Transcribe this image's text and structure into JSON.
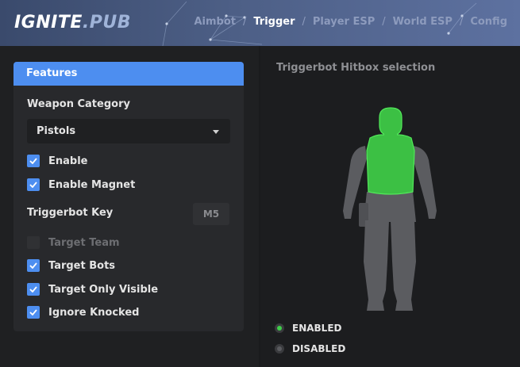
{
  "header": {
    "logo_main": "IGNITE",
    "logo_suffix": ".PUB",
    "tabs": [
      {
        "label": "Aimbot",
        "active": false
      },
      {
        "label": "Trigger",
        "active": true
      },
      {
        "label": "Player ESP",
        "active": false
      },
      {
        "label": "World ESP",
        "active": false
      },
      {
        "label": "Config",
        "active": false
      }
    ],
    "separator": "/"
  },
  "features": {
    "title": "Features",
    "weapon_category_label": "Weapon Category",
    "weapon_category_value": "Pistols",
    "enable": {
      "label": "Enable",
      "checked": true
    },
    "enable_magnet": {
      "label": "Enable Magnet",
      "checked": true
    },
    "trigger_key_label": "Triggerbot Key",
    "trigger_key_value": "M5",
    "target_team": {
      "label": "Target Team",
      "checked": false
    },
    "target_bots": {
      "label": "Target Bots",
      "checked": true
    },
    "target_only_visible": {
      "label": "Target Only Visible",
      "checked": true
    },
    "ignore_knocked": {
      "label": "Ignore Knocked",
      "checked": true
    }
  },
  "hitbox": {
    "title": "Triggerbot Hitbox selection",
    "legend_enabled": "ENABLED",
    "legend_disabled": "DISABLED",
    "enabled_parts": [
      "head",
      "chest"
    ]
  },
  "colors": {
    "accent": "#4d8ef0",
    "enabled_green": "#3fcf4a",
    "disabled_gray": "#5b5c60",
    "header_start": "#3a4a6c",
    "header_end": "#5d71a0"
  }
}
